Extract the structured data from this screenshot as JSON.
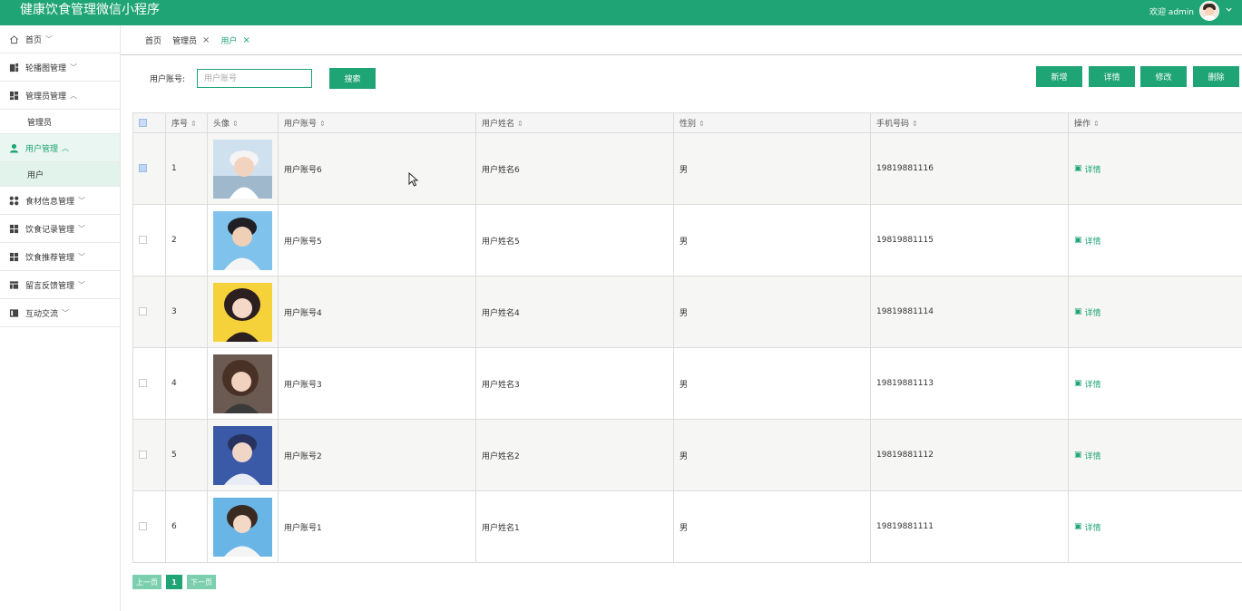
{
  "header": {
    "app_title": "健康饮食管理微信小程序",
    "welcome": "欢迎 admin"
  },
  "sidebar": {
    "items": [
      {
        "label": "首页",
        "icon": "home-icon",
        "expanded": false
      },
      {
        "label": "轮播图管理",
        "icon": "carousel-icon",
        "expanded": false
      },
      {
        "label": "管理员管理",
        "icon": "grid-icon",
        "expanded": true,
        "children": [
          "管理员"
        ]
      },
      {
        "label": "用户管理",
        "icon": "user-icon",
        "expanded": true,
        "active": true,
        "children": [
          "用户"
        ]
      },
      {
        "label": "食材信息管理",
        "icon": "dots-icon",
        "expanded": false
      },
      {
        "label": "饮食记录管理",
        "icon": "grid-icon",
        "expanded": false
      },
      {
        "label": "饮食推荐管理",
        "icon": "grid-icon",
        "expanded": false
      },
      {
        "label": "留言反馈管理",
        "icon": "table-icon",
        "expanded": false
      },
      {
        "label": "互动交流",
        "icon": "book-icon",
        "expanded": false
      }
    ]
  },
  "tabs": [
    {
      "label": "首页",
      "closable": false
    },
    {
      "label": "管理员",
      "closable": true
    },
    {
      "label": "用户",
      "closable": true,
      "active": true
    }
  ],
  "search": {
    "label": "用户账号:",
    "placeholder": "用户账号",
    "value": "",
    "button": "搜索"
  },
  "actions": {
    "add": "新增",
    "detail": "详情",
    "edit": "修改",
    "delete": "删除"
  },
  "table": {
    "columns": [
      "序号",
      "头像",
      "用户账号",
      "用户姓名",
      "性别",
      "手机号码",
      "操作"
    ],
    "rows": [
      {
        "index": "1",
        "account": "用户账号6",
        "name": "用户姓名6",
        "gender": "男",
        "phone": "19819881116",
        "action": "详情",
        "checked": true
      },
      {
        "index": "2",
        "account": "用户账号5",
        "name": "用户姓名5",
        "gender": "男",
        "phone": "19819881115",
        "action": "详情",
        "checked": false
      },
      {
        "index": "3",
        "account": "用户账号4",
        "name": "用户姓名4",
        "gender": "男",
        "phone": "19819881114",
        "action": "详情",
        "checked": false
      },
      {
        "index": "4",
        "account": "用户账号3",
        "name": "用户姓名3",
        "gender": "男",
        "phone": "19819881113",
        "action": "详情",
        "checked": false
      },
      {
        "index": "5",
        "account": "用户账号2",
        "name": "用户姓名2",
        "gender": "男",
        "phone": "19819881112",
        "action": "详情",
        "checked": false
      },
      {
        "index": "6",
        "account": "用户账号1",
        "name": "用户姓名1",
        "gender": "男",
        "phone": "19819881111",
        "action": "详情",
        "checked": false
      }
    ]
  },
  "pagination": {
    "prev": "上一页",
    "current": "1",
    "next": "下一页"
  },
  "colors": {
    "primary": "#1fa475",
    "primary_light": "#7ccfae",
    "active_bg": "#eaf6f1"
  }
}
